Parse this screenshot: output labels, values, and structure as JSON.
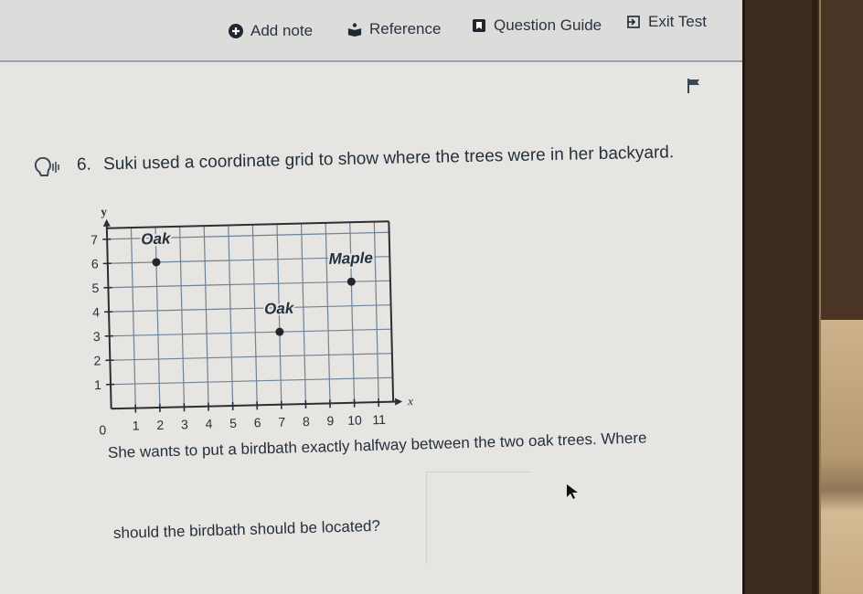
{
  "toolbar": {
    "add_note": {
      "label": "Add note",
      "icon": "plus-circle-icon"
    },
    "reference": {
      "label": "Reference",
      "icon": "reader-book-icon"
    },
    "question_guide": {
      "label": "Question Guide",
      "icon": "guide-bookmark-icon"
    },
    "exit_test": {
      "label": "Exit Test",
      "icon": "exit-arrow-icon"
    }
  },
  "question": {
    "number": "6.",
    "text": "Suki used a coordinate grid to show where the trees were in her backyard.",
    "prompt_line1": "She wants to put a birdbath exactly halfway between the two oak trees. Where",
    "prompt_line2": "should the birdbath should be located?"
  },
  "chart_data": {
    "type": "scatter",
    "title": "",
    "xlabel": "x",
    "ylabel": "y",
    "xlim": [
      0,
      11
    ],
    "ylim": [
      0,
      7
    ],
    "grid": true,
    "x_ticks": [
      "0",
      "1",
      "2",
      "3",
      "4",
      "5",
      "6",
      "7",
      "8",
      "9",
      "10",
      "11"
    ],
    "y_ticks": [
      "1",
      "2",
      "3",
      "4",
      "5",
      "6",
      "7"
    ],
    "points": [
      {
        "label": "Oak",
        "x": 2,
        "y": 6
      },
      {
        "label": "Oak",
        "x": 7,
        "y": 3
      },
      {
        "label": "Maple",
        "x": 10,
        "y": 5
      }
    ]
  },
  "colors": {
    "text": "#25303d",
    "grid": "#6f8297",
    "axis": "#2a2f36",
    "point": "#23272d",
    "toolbar_bg": "#dcdcda",
    "page_bg": "#e6e5e1"
  }
}
